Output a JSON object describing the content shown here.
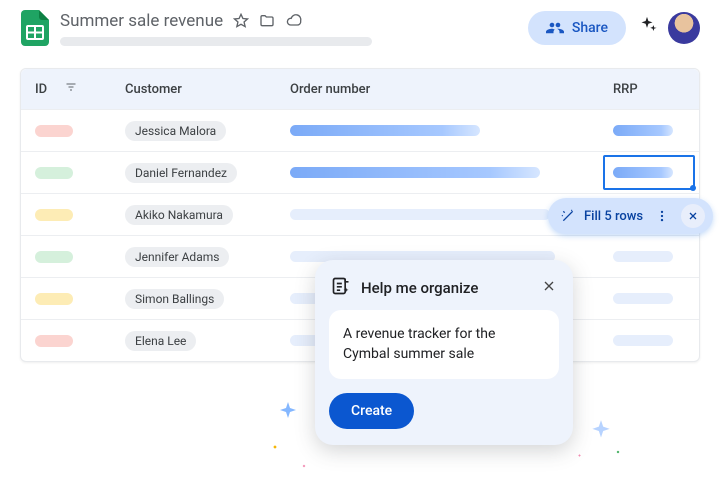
{
  "header": {
    "doc_title": "Summer sale revenue",
    "share_label": "Share"
  },
  "table": {
    "columns": {
      "id": "ID",
      "customer": "Customer",
      "order": "Order number",
      "rrp": "RRP"
    },
    "rows": [
      {
        "id_color": "red",
        "customer": "Jessica Malora",
        "order_w": 190,
        "rrp": true,
        "highlight": false
      },
      {
        "id_color": "green",
        "customer": "Daniel Fernandez",
        "order_w": 250,
        "rrp": true,
        "highlight": true
      },
      {
        "id_color": "yellow",
        "customer": "Akiko Nakamura",
        "order_w": 260,
        "rrp": false,
        "faded": true
      },
      {
        "id_color": "green",
        "customer": "Jennifer Adams",
        "order_w": 265,
        "rrp": false,
        "faded": true
      },
      {
        "id_color": "yellow",
        "customer": "Simon Ballings",
        "order_w": 45,
        "rrp": false,
        "faded": true
      },
      {
        "id_color": "red",
        "customer": "Elena Lee",
        "order_w": 40,
        "rrp": false,
        "faded": true
      }
    ]
  },
  "fill_chip": {
    "label": "Fill 5 rows"
  },
  "help_panel": {
    "title": "Help me organize",
    "prompt": "A revenue tracker for the Cymbal summer sale",
    "create_label": "Create"
  }
}
